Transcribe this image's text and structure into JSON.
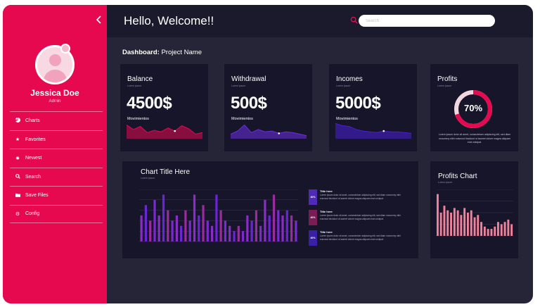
{
  "header": {
    "welcome": "Hello, Welcome!!",
    "search_placeholder": "Search"
  },
  "breadcrumb": {
    "label": "Dashboard:",
    "project": "Project Name"
  },
  "user": {
    "name": "Jessica Doe",
    "role": "Admin"
  },
  "sidebar": {
    "items": [
      {
        "label": "Charts",
        "icon": "chart-icon"
      },
      {
        "label": "Favorites",
        "icon": "star-icon"
      },
      {
        "label": "Newest",
        "icon": "sun-icon"
      },
      {
        "label": "Search",
        "icon": "search-icon"
      },
      {
        "label": "Save Files",
        "icon": "folder-icon"
      },
      {
        "label": "Config",
        "icon": "gear-icon"
      }
    ]
  },
  "cards": {
    "balance": {
      "title": "Balance",
      "sub": "Lorem ipsum",
      "value": "4500$",
      "caption": "Movimientos"
    },
    "withdrawal": {
      "title": "Withdrawal",
      "sub": "Lorem ipsum",
      "value": "500$",
      "caption": "Movimientos"
    },
    "incomes": {
      "title": "Incomes",
      "sub": "Lorem ipsum",
      "value": "5000$",
      "caption": "Movimientos"
    },
    "profits": {
      "title": "Profits",
      "sub": "Lorem ipsum",
      "percent_label": "70%",
      "percent": 0.7,
      "description": "Lorem ipsum dolor sit amet, consectetuer adipiscing elit, sed diam nonummy nibh euismod tincidunt ut laoreet dolore magna aliquam erat volutpat."
    }
  },
  "main_chart": {
    "title": "Chart Title Here",
    "sub": "Lorem ipsum",
    "legend": [
      {
        "badge": "40%",
        "title": "Title here",
        "text": "Lorem ipsum dolor sit amet, consectetuer adipiscing elit, sed diam nonummy nibh euismod tincidunt ut laoreet dolore magna aliquam erat volutpat.",
        "color": "#4e2ab6"
      },
      {
        "badge": "40%",
        "title": "Title here",
        "text": "Lorem ipsum dolor sit amet, consectetuer adipiscing elit, sed diam nonummy nibh euismod tincidunt ut laoreet dolore magna aliquam erat volutpat.",
        "color": "#7a1d56"
      },
      {
        "badge": "40%",
        "title": "Title here",
        "text": "Lorem ipsum dolor sit amet, consectetuer adipiscing elit, sed diam nonummy nibh euismod tincidunt ut laoreet dolore magna aliquam erat volutpat.",
        "color": "#3a1fa8"
      }
    ]
  },
  "profits_chart": {
    "title": "Profits Chart",
    "sub": "Lorem ipsum"
  },
  "chart_data": [
    {
      "type": "area",
      "name": "balance-sparkline",
      "color": "#e6094f",
      "values": [
        18,
        12,
        16,
        8,
        11,
        9,
        14,
        10,
        17,
        13,
        6,
        8
      ]
    },
    {
      "type": "area",
      "name": "withdrawal-sparkline",
      "color": "#6b2fe0",
      "values": [
        6,
        10,
        18,
        8,
        12,
        9,
        10,
        7,
        9,
        8,
        6,
        4
      ]
    },
    {
      "type": "area",
      "name": "incomes-sparkline",
      "color": "#4b1fd6",
      "values": [
        20,
        17,
        16,
        12,
        10,
        9,
        8,
        10,
        9,
        9,
        8,
        7
      ]
    },
    {
      "type": "pie",
      "name": "profits-donut",
      "values": [
        70,
        30
      ],
      "colors": [
        "#e6094f",
        "#f2d6e0"
      ]
    },
    {
      "type": "bar",
      "name": "main-chart",
      "ylim": [
        0,
        10
      ],
      "series": [
        {
          "values": [
            5,
            7,
            4,
            8,
            5,
            9,
            6,
            4,
            5,
            3,
            6,
            4,
            9,
            5,
            7,
            4,
            3,
            9,
            6,
            4,
            3,
            2,
            3,
            2,
            5,
            4,
            6,
            3,
            8,
            5,
            9,
            6,
            5,
            6,
            5,
            4
          ],
          "colors": [
            "#8a2cc6",
            "#6b25d6",
            "#9b2b9e",
            "#7b2ad0"
          ]
        }
      ]
    },
    {
      "type": "bar",
      "name": "profits-chart",
      "ylim": [
        0,
        10
      ],
      "values": [
        9,
        5,
        6.5,
        5.5,
        5,
        6,
        5.5,
        4.5,
        6,
        5,
        5.5,
        4,
        4.5,
        3,
        2,
        1.5,
        1.5,
        2,
        3,
        2.5,
        3,
        3.5,
        2.5
      ],
      "color": "#f0829b"
    }
  ]
}
